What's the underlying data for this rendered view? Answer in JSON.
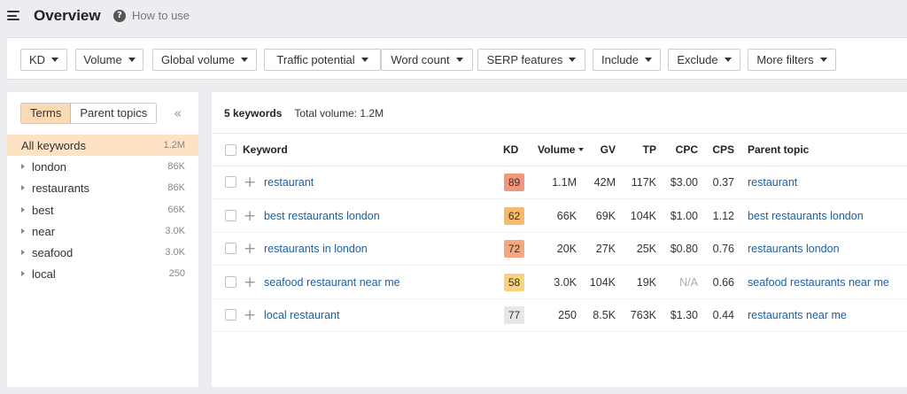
{
  "header": {
    "title": "Overview",
    "help_label": "How to use",
    "help_icon": "question-circle-icon",
    "menu_icon": "hamburger-menu-icon"
  },
  "filters": [
    "KD",
    "Volume",
    "Global volume",
    "Traffic potential",
    "Word count",
    "SERP features",
    "Include",
    "Exclude",
    "More filters"
  ],
  "sidebar": {
    "tabs": [
      "Terms",
      "Parent topics"
    ],
    "active_tab": "Terms",
    "collapse_icon": "double-chevron-left-icon",
    "items": [
      {
        "label": "All keywords",
        "count": "1.2M",
        "active": true
      },
      {
        "label": "london",
        "count": "86K"
      },
      {
        "label": "restaurants",
        "count": "86K"
      },
      {
        "label": "best",
        "count": "66K"
      },
      {
        "label": "near",
        "count": "3.0K"
      },
      {
        "label": "seafood",
        "count": "3.0K"
      },
      {
        "label": "local",
        "count": "250"
      }
    ]
  },
  "main": {
    "keyword_count": "5 keywords",
    "total_volume": "Total volume: 1.2M",
    "columns": {
      "keyword": "Keyword",
      "kd": "KD",
      "volume": "Volume",
      "gv": "GV",
      "tp": "TP",
      "cpc": "CPC",
      "cps": "CPS",
      "parent": "Parent topic"
    },
    "rows": [
      {
        "keyword": "restaurant",
        "kd": "89",
        "kd_color": "#f4967c",
        "volume": "1.1M",
        "gv": "42M",
        "tp": "117K",
        "cpc": "$3.00",
        "cps": "0.37",
        "parent": "restaurant"
      },
      {
        "keyword": "best restaurants london",
        "kd": "62",
        "kd_color": "#f7b96b",
        "volume": "66K",
        "gv": "69K",
        "tp": "104K",
        "cpc": "$1.00",
        "cps": "1.12",
        "parent": "best restaurants london"
      },
      {
        "keyword": "restaurants in london",
        "kd": "72",
        "kd_color": "#f5a77f",
        "volume": "20K",
        "gv": "27K",
        "tp": "25K",
        "cpc": "$0.80",
        "cps": "0.76",
        "parent": "restaurants london"
      },
      {
        "keyword": "seafood restaurant near me",
        "kd": "58",
        "kd_color": "#f9d27d",
        "volume": "3.0K",
        "gv": "104K",
        "tp": "19K",
        "cpc": "N/A",
        "cps": "0.66",
        "parent": "seafood restaurants near me"
      },
      {
        "keyword": "local restaurant",
        "kd": "77",
        "kd_color": "#e6e7e9",
        "volume": "250",
        "gv": "8.5K",
        "tp": "763K",
        "cpc": "$1.30",
        "cps": "0.44",
        "parent": "restaurants near me"
      }
    ]
  }
}
